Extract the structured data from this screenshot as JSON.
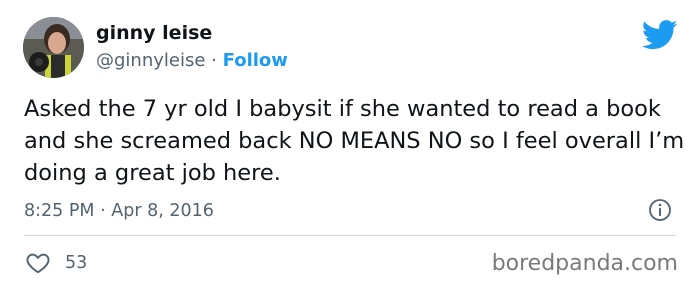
{
  "tweet": {
    "author": {
      "display_name": "ginny leise",
      "handle": "@ginnyleise",
      "separator": "·",
      "follow_label": "Follow"
    },
    "text": "Asked the 7 yr old I babysit if she wanted to read a book and she screamed back NO MEANS NO so I feel overall I’m doing a great job here.",
    "time": "8:25 PM",
    "date": "Apr 8, 2016",
    "likes": "53"
  },
  "icons": {
    "brand": "twitter-bird-icon",
    "info": "info-icon",
    "like": "heart-icon"
  },
  "colors": {
    "accent": "#1d9bf0",
    "text": "#0f1419",
    "secondary": "#536471",
    "divider": "#cfd9de"
  },
  "watermark": "boredpanda.com"
}
